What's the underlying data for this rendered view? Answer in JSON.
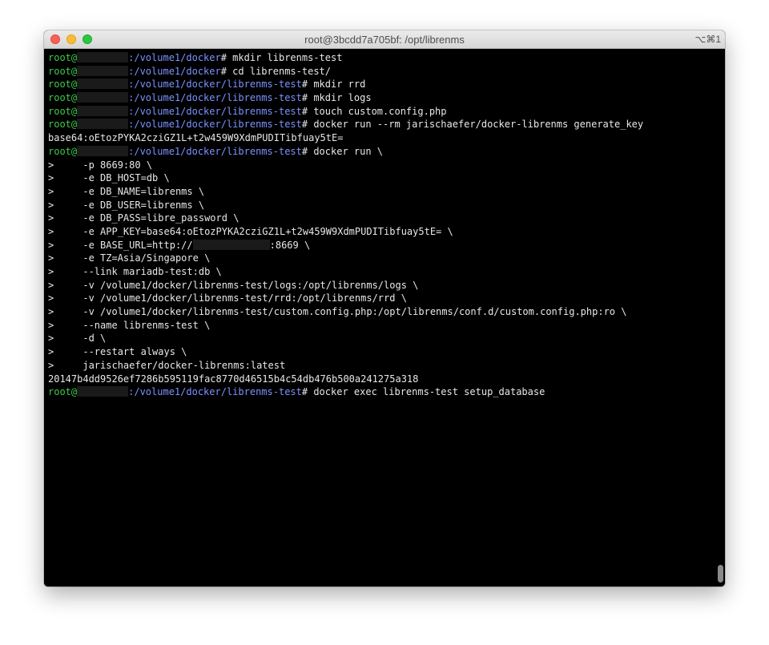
{
  "window": {
    "title": "root@3bcdd7a705bf: /opt/librenms",
    "shortcut": "⌥⌘1"
  },
  "prompt": {
    "user": "root@",
    "suffix": "# "
  },
  "commands": {
    "c1": {
      "path": ":/volume1/docker",
      "cmd": "mkdir librenms-test"
    },
    "c2": {
      "path": ":/volume1/docker",
      "cmd": "cd librenms-test/"
    },
    "c3": {
      "path": ":/volume1/docker/librenms-test",
      "cmd": "mkdir rrd"
    },
    "c4": {
      "path": ":/volume1/docker/librenms-test",
      "cmd": "mkdir logs"
    },
    "c5": {
      "path": ":/volume1/docker/librenms-test",
      "cmd": "touch custom.config.php"
    },
    "c6": {
      "path": ":/volume1/docker/librenms-test",
      "cmd": "docker run --rm jarischaefer/docker-librenms generate_key"
    },
    "c7": {
      "path": ":/volume1/docker/librenms-test",
      "cmd": "docker run \\"
    },
    "c8": {
      "path": ":/volume1/docker/librenms-test",
      "cmd": "docker exec librenms-test setup_database"
    }
  },
  "outputs": {
    "key": "base64:oEtozPYKA2cziGZ1L+t2w459W9XdmPUDITibfuay5tE=",
    "container_id": "20147b4dd9526ef7286b595119fac8770d46515b4c54db476b500a241275a318"
  },
  "continuation": {
    "l1": ">     -p 8669:80 \\",
    "l2": ">     -e DB_HOST=db \\",
    "l3": ">     -e DB_NAME=librenms \\",
    "l4": ">     -e DB_USER=librenms \\",
    "l5": ">     -e DB_PASS=libre_password \\",
    "l6": ">     -e APP_KEY=base64:oEtozPYKA2cziGZ1L+t2w459W9XdmPUDITibfuay5tE= \\",
    "l7_pre": ">     -e BASE_URL=http://",
    "l7_post": ":8669 \\",
    "l8": ">     -e TZ=Asia/Singapore \\",
    "l9": ">     --link mariadb-test:db \\",
    "l10": ">     -v /volume1/docker/librenms-test/logs:/opt/librenms/logs \\",
    "l11": ">     -v /volume1/docker/librenms-test/rrd:/opt/librenms/rrd \\",
    "l12": ">     -v /volume1/docker/librenms-test/custom.config.php:/opt/librenms/conf.d/custom.config.php:ro \\",
    "l13": ">     --name librenms-test \\",
    "l14": ">     -d \\",
    "l15": ">     --restart always \\",
    "l16": ">     jarischaefer/docker-librenms:latest"
  }
}
